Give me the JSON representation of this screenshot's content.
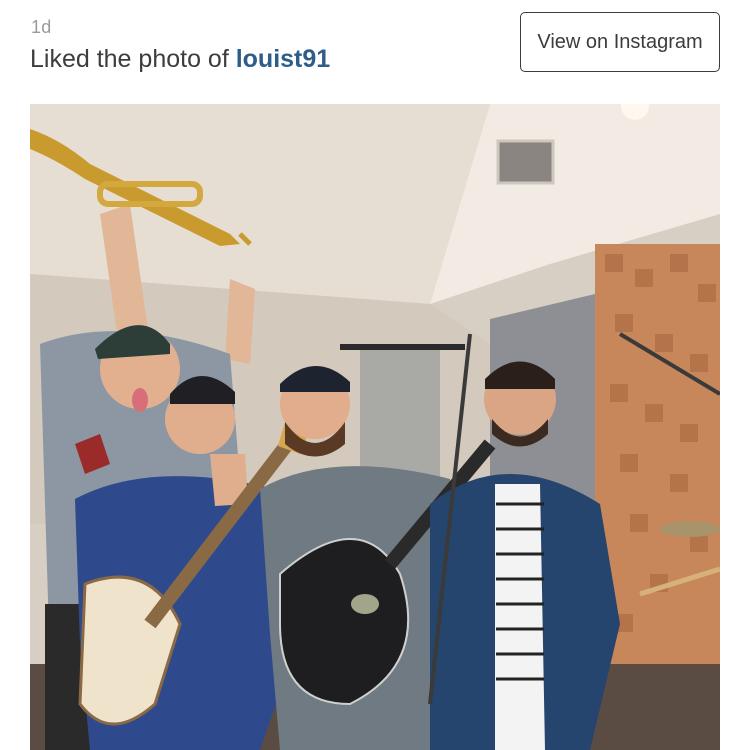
{
  "activity": {
    "time": "1d",
    "action_prefix": "Liked the photo of ",
    "username": "louist91"
  },
  "actions": {
    "view_label": "View on Instagram"
  },
  "photo": {
    "subject": "group-photo-in-recording-studio"
  },
  "colors": {
    "link": "#2f5d8a",
    "muted": "#9a9a9a",
    "text": "#3d3d3d",
    "border": "#3c3c3c"
  }
}
